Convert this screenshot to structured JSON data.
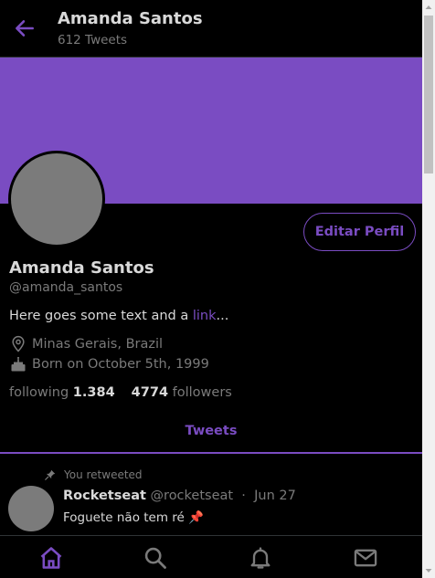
{
  "header": {
    "title": "Amanda Santos",
    "subtitle": "612 Tweets"
  },
  "profile": {
    "edit_button": "Editar Perfil",
    "name": "Amanda Santos",
    "handle": "@amanda_santos",
    "bio_text": "Here goes some text and a ",
    "bio_link": "link",
    "bio_suffix": "...",
    "location": "Minas Gerais, Brazil",
    "birthday": "Born on October 5th, 1999",
    "following_label": "following",
    "following_count": "1.384",
    "followers_count": "4774",
    "followers_label": "followers"
  },
  "tabs": {
    "tweets": "Tweets"
  },
  "tweet": {
    "retweet_label": "You retweeted",
    "author": "Rocketseat",
    "author_handle": "@rocketseat",
    "separator": "·",
    "date": "Jun 27",
    "text": "Foguete não tem ré 📌"
  },
  "colors": {
    "accent": "#7a4cc2",
    "background": "#000000",
    "text": "#d9d9d9",
    "muted": "#7a7a7a"
  },
  "icons": {
    "back": "arrow-left-icon",
    "location": "location-pin-icon",
    "birthday": "cake-icon",
    "retweet": "pin-icon",
    "nav": [
      "home-icon",
      "search-icon",
      "bell-icon",
      "mail-icon"
    ]
  }
}
